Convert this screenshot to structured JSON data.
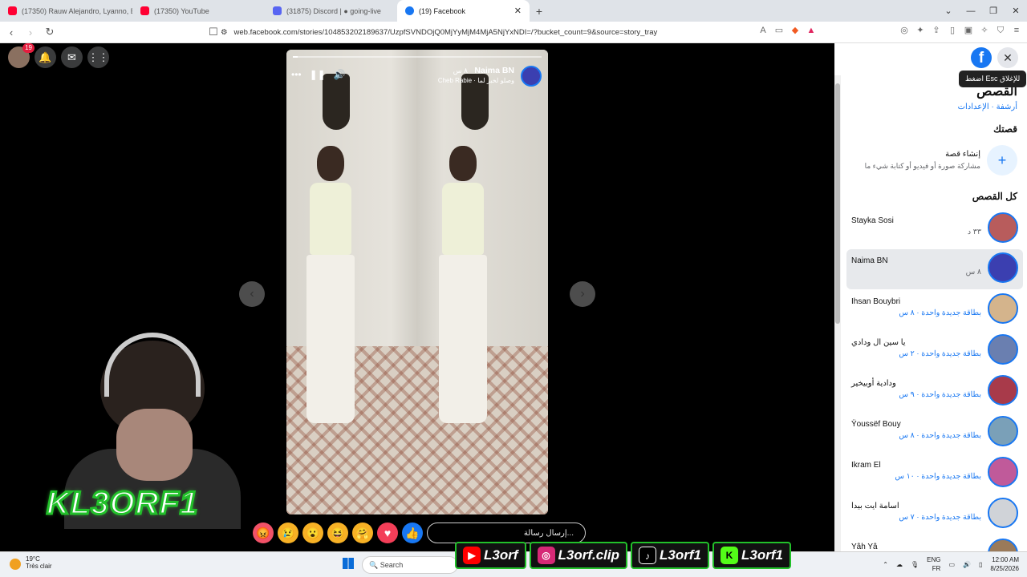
{
  "tabs": [
    {
      "label": "(17350) Rauw Alejandro, Lyanno, Bra",
      "color": "#ff0033"
    },
    {
      "label": "(17350) YouTube",
      "color": "#ff0033"
    },
    {
      "label": "(31875) Discord | ● going-live",
      "color": "#5865f2"
    },
    {
      "label": "(19) Facebook",
      "color": "#1877f2"
    }
  ],
  "address": {
    "url": "web.facebook.com/stories/104853202189637/UzpfSVNDOjQ0MjYyMjM4MjA5NjYxNDI=/?bucket_count=9&source=story_tray"
  },
  "top": {
    "notif_count": "19"
  },
  "story": {
    "name": "Naima BN",
    "time": "٨ س",
    "music": "Cheb Rabie · وصلو لخبر لما",
    "message_placeholder": "إرسال رسالة..."
  },
  "reactions": [
    {
      "icon": "angry-icon",
      "glyph": "😡",
      "color": "#f25268"
    },
    {
      "icon": "sad-icon",
      "glyph": "😢",
      "color": "#f7b125"
    },
    {
      "icon": "wow-icon",
      "glyph": "😮",
      "color": "#f7b125"
    },
    {
      "icon": "haha-icon",
      "glyph": "😆",
      "color": "#f7b125"
    },
    {
      "icon": "care-icon",
      "glyph": "🤗",
      "color": "#f7b125"
    },
    {
      "icon": "love-icon",
      "glyph": "♥",
      "color": "#f33e58"
    },
    {
      "icon": "like-icon",
      "glyph": "👍",
      "color": "#1877f2"
    }
  ],
  "overlay": {
    "brand": "KL3ORF1",
    "socials": [
      {
        "icon": "youtube-icon",
        "label": "L3orf",
        "color": "#ff0000"
      },
      {
        "icon": "instagram-icon",
        "label": "L3orf.clip",
        "color": "#d62976"
      },
      {
        "icon": "tiktok-icon",
        "label": "L3orf1",
        "color": "#000000"
      },
      {
        "icon": "kick-icon",
        "label": "L3orf1",
        "color": "#53fc18"
      }
    ]
  },
  "sidebar": {
    "tooltip": "اضغط Esc للإغلاق",
    "title": "القصص",
    "links": "أرشفة · الإعدادات",
    "your_story": "قصتك",
    "create_title": "إنشاء قصة",
    "create_sub": "مشاركة صورة أو فيديو أو كتابة شيء ما",
    "all_stories": "كل القصص",
    "stories": [
      {
        "name": "Stayka Sosi",
        "sub": "٣٣ د"
      },
      {
        "name": "Naima BN",
        "sub": "٨ س"
      },
      {
        "name": "Ihsan Bouybri",
        "sub": "بطاقة جديدة واحدة · ٨ س"
      },
      {
        "name": "يا سين ال ودادي",
        "sub": "بطاقة جديدة واحدة · ٢ س"
      },
      {
        "name": "ودادية أوبيخير",
        "sub": "بطاقة جديدة واحدة · ٩ س"
      },
      {
        "name": "Ÿoussëf Bouy",
        "sub": "بطاقة جديدة واحدة · ٨ س"
      },
      {
        "name": "Ikram El",
        "sub": "بطاقة جديدة واحدة · ١٠ س"
      },
      {
        "name": "اسامة ايت بيدا",
        "sub": "بطاقة جديدة واحدة · ٧ س"
      },
      {
        "name": "Yâh Yâ",
        "sub": ""
      }
    ]
  },
  "taskbar": {
    "temp": "19°C",
    "weather": "Très clair",
    "search": "Search",
    "lang1": "ENG",
    "lang2": "FR",
    "time": "12:00 AM",
    "date": "8/25/2026"
  }
}
